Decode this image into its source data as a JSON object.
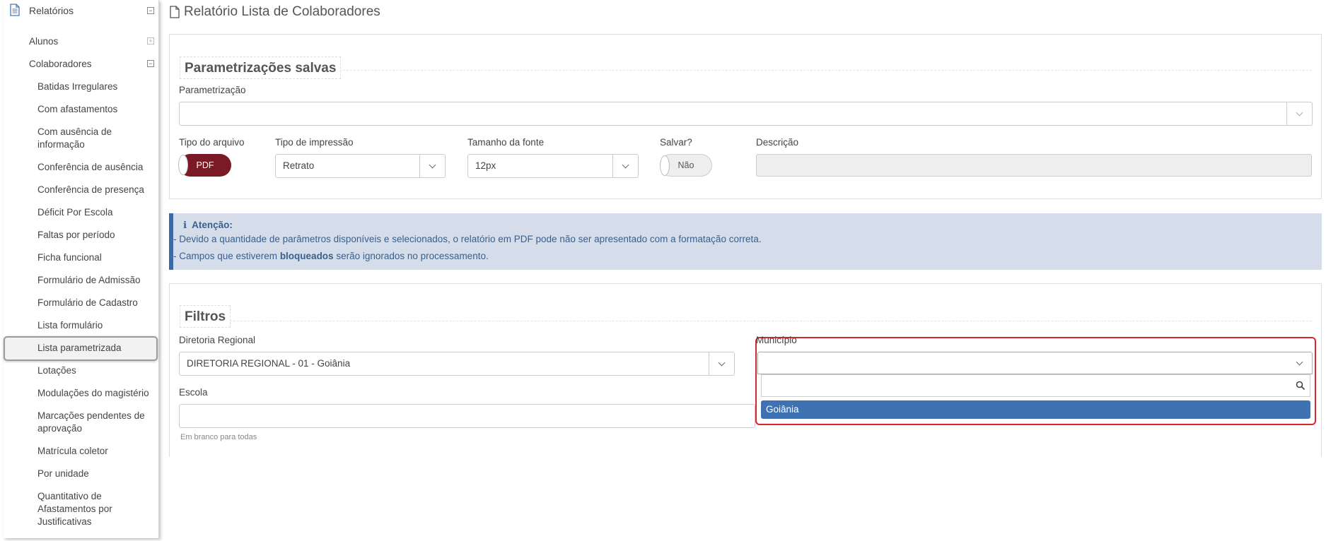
{
  "page": {
    "title": "Relatório Lista de Colaboradores"
  },
  "sidebar": {
    "root": {
      "label": "Relatórios",
      "toggle": "⊟"
    },
    "groups": [
      {
        "label": "Alunos",
        "toggle": "⊞"
      },
      {
        "label": "Colaboradores",
        "toggle": "⊟"
      }
    ],
    "items": [
      "Batidas Irregulares",
      "Com afastamentos",
      "Com ausência de informação",
      "Conferência de ausência",
      "Conferência de presença",
      "Déficit Por Escola",
      "Faltas por período",
      "Ficha funcional",
      "Formulário de Admissão",
      "Formulário de Cadastro",
      "Lista formulário",
      "Lista parametrizada",
      "Lotações",
      "Modulações do magistério",
      "Marcações pendentes de aprovação",
      "Matrícula coletor",
      "Por unidade",
      "Quantitativo de Afastamentos por Justificativas"
    ],
    "active_item": "Lista parametrizada"
  },
  "saved": {
    "legend": "Parametrizações salvas",
    "param_label": "Parametrização",
    "param_value": "",
    "file_type_label": "Tipo do arquivo",
    "file_type_value": "PDF",
    "print_type_label": "Tipo de impressão",
    "print_type_value": "Retrato",
    "font_size_label": "Tamanho da fonte",
    "font_size_value": "12px",
    "save_label": "Salvar?",
    "save_value": "Não",
    "description_label": "Descrição",
    "description_value": ""
  },
  "alert": {
    "icon": "ℹ",
    "title": "Atenção:",
    "line1": "- Devido a quantidade de parâmetros disponíveis e selecionados, o relatório em PDF pode não ser apresentado com a formatação correta.",
    "line2_pre": "- Campos que estiverem ",
    "line2_bold": "bloqueados",
    "line2_post": " serão ignorados no processamento."
  },
  "filters": {
    "legend": "Filtros",
    "diretoria_label": "Diretoria Regional",
    "diretoria_value": "DIRETORIA REGIONAL - 01 - Goiânia",
    "municipio_label": "Município",
    "municipio_value": "",
    "municipio_search": "",
    "municipio_options": [
      "Goiânia"
    ],
    "escola_label": "Escola",
    "escola_value": "",
    "escola_hint": "Em branco para todas"
  },
  "colors": {
    "accent": "#3f72b3",
    "pdf": "#7a1a24",
    "highlight": "#d6262e",
    "alert_bg": "#d4dde9"
  }
}
